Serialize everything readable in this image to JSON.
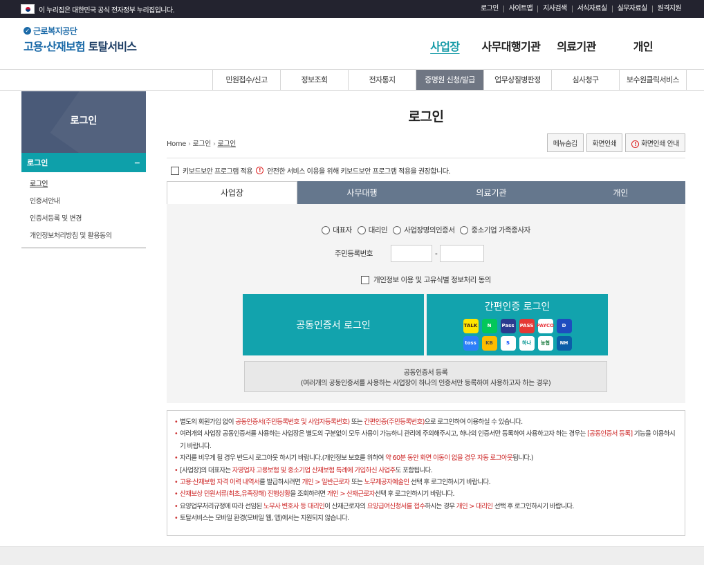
{
  "gov_banner": {
    "text": "이 누리집은 대한민국 공식 전자정부 누리집입니다.",
    "links": [
      "로그인",
      "사이트맵",
      "지사검색",
      "서식자료실",
      "실무자료실",
      "원격지원"
    ]
  },
  "logo": {
    "org": "근로복지공단",
    "brand1": "고용·산재보험",
    "brand2": " 토탈서비스"
  },
  "main_nav": [
    "사업장",
    "사무대행기관",
    "의료기관",
    "개인"
  ],
  "sub_nav": [
    "민원접수/신고",
    "정보조회",
    "전자통지",
    "증명원 신청/발급",
    "업무상질병판정",
    "심사청구",
    "보수원클릭서비스"
  ],
  "sidebar": {
    "title": "로그인",
    "category": "로그인",
    "collapse": "−",
    "items": [
      "로그인",
      "인증서안내",
      "인증서등록 및 변경",
      "개인정보처리방침 및 활용동의"
    ]
  },
  "page": {
    "title": "로그인",
    "crumb": [
      "Home",
      "로그인",
      "로그인"
    ],
    "buttons": [
      "메뉴숨김",
      "화면인쇄",
      "화면인쇄 안내"
    ]
  },
  "keyboard": {
    "label": "키보드보안 프로그램 적용",
    "notice": "안전한 서비스 이용을 위해 키보드보안 프로그램 적용을 권장합니다."
  },
  "tabs": [
    "사업장",
    "사무대행",
    "의료기관",
    "개인"
  ],
  "login": {
    "radios": [
      "대표자",
      "대리인",
      "사업장명의인증서",
      "중소기업 가족종사자"
    ],
    "rrn_label": "주민등록번호",
    "dash": "-",
    "agree": "개인정보 이용 및 고유식별 정보처리 동의",
    "cert_btn": "공동인증서 로그인",
    "simple_btn": "간편인증 로그인",
    "simple_icons": [
      {
        "label": "TALK",
        "bg": "#fee500",
        "fg": "#3c1e1e"
      },
      {
        "label": "N",
        "bg": "#03c75a",
        "fg": "#fff"
      },
      {
        "label": "Pass",
        "bg": "#2a3b8f",
        "fg": "#fff"
      },
      {
        "label": "PASS",
        "bg": "#e53935",
        "fg": "#fff"
      },
      {
        "label": "PAYCO",
        "bg": "#fff",
        "fg": "#e8343b"
      },
      {
        "label": "D",
        "bg": "#1e4dbf",
        "fg": "#fff"
      },
      {
        "label": "toss",
        "bg": "#2d7ff9",
        "fg": "#fff"
      },
      {
        "label": "KB",
        "bg": "#ffbc00",
        "fg": "#545045"
      },
      {
        "label": "S",
        "bg": "#fff",
        "fg": "#0046ff"
      },
      {
        "label": "하나",
        "bg": "#fff",
        "fg": "#009490"
      },
      {
        "label": "농협",
        "bg": "#fff",
        "fg": "#1a7a3e"
      },
      {
        "label": "NH",
        "bg": "#0b5ea8",
        "fg": "#fff"
      }
    ],
    "register_title": "공동인증서 등록",
    "register_desc": "(여러개의 공동인증서를 사용하는 사업장이 하나의 인증서만 등록하여 사용하고자 하는 경우)"
  },
  "notes": [
    [
      [
        "별도의 회원가입 없이 ",
        0
      ],
      [
        "공동인증서(주민등록번호 및 사업자등록번호)",
        1
      ],
      [
        " 또는 ",
        0
      ],
      [
        "간편인증(주민등록번호)",
        1
      ],
      [
        "으로 로그인하여 이용하실 수 있습니다.",
        0
      ]
    ],
    [
      [
        "여러개의 사업장 공동인증서를 사용하는 사업장은 별도의 구분없이 모두 사용이 가능하니 관리에 주의해주시고, 하나의 인증서만 등록하여 사용하고자 하는 경우는 ",
        0
      ],
      [
        "[공동인증서 등록]",
        1
      ],
      [
        " 기능을 이용하시기 바랍니다.",
        0
      ]
    ],
    [
      [
        "자리를 비우게 될 경우 반드시 로그아웃 하시기 바랍니다.(개인정보 보호를 위하여 ",
        0
      ],
      [
        "약 60분 동안 화면 이동이 없을 경우 자동 로그아웃",
        1
      ],
      [
        "됩니다.)",
        0
      ]
    ],
    [
      [
        "[사업장]의 대표자는 ",
        0
      ],
      [
        "자영업자 고용보험 및 중소기업 산재보험 특례에 가입하신 사업주",
        1
      ],
      [
        "도 포함됩니다.",
        0
      ]
    ],
    [
      [
        "고용·산재보험 자격 이력 내역서",
        1
      ],
      [
        "를 발급하시려면 ",
        0
      ],
      [
        "개인 > 일반근로자",
        1
      ],
      [
        " 또는 ",
        0
      ],
      [
        "노무제공자예술인",
        1
      ],
      [
        " 선택 후 로그인하시기 바랍니다.",
        0
      ]
    ],
    [
      [
        "산재보상 민원서류(최초,유족장해) 진행상황",
        1
      ],
      [
        "을 조회하려면 ",
        0
      ],
      [
        "개인 > 산재근로자",
        1
      ],
      [
        "선택 후 로그인하시기 바랍니다.",
        0
      ]
    ],
    [
      [
        "요양업무처리규정에 따라 선임된 ",
        0
      ],
      [
        "노무사 변호사 등 대리인",
        1
      ],
      [
        "이 산재근로자의 ",
        0
      ],
      [
        "요양급여신청서를 접수",
        1
      ],
      [
        "하시는 경우 ",
        0
      ],
      [
        "개인 > 대리인",
        1
      ],
      [
        " 선택 후 로그인하시기 바랍니다.",
        0
      ]
    ],
    [
      [
        "토탈서비스는 모바일 환경(모바일 웹, 앱)에서는 지원되지 않습니다.",
        0
      ]
    ]
  ]
}
